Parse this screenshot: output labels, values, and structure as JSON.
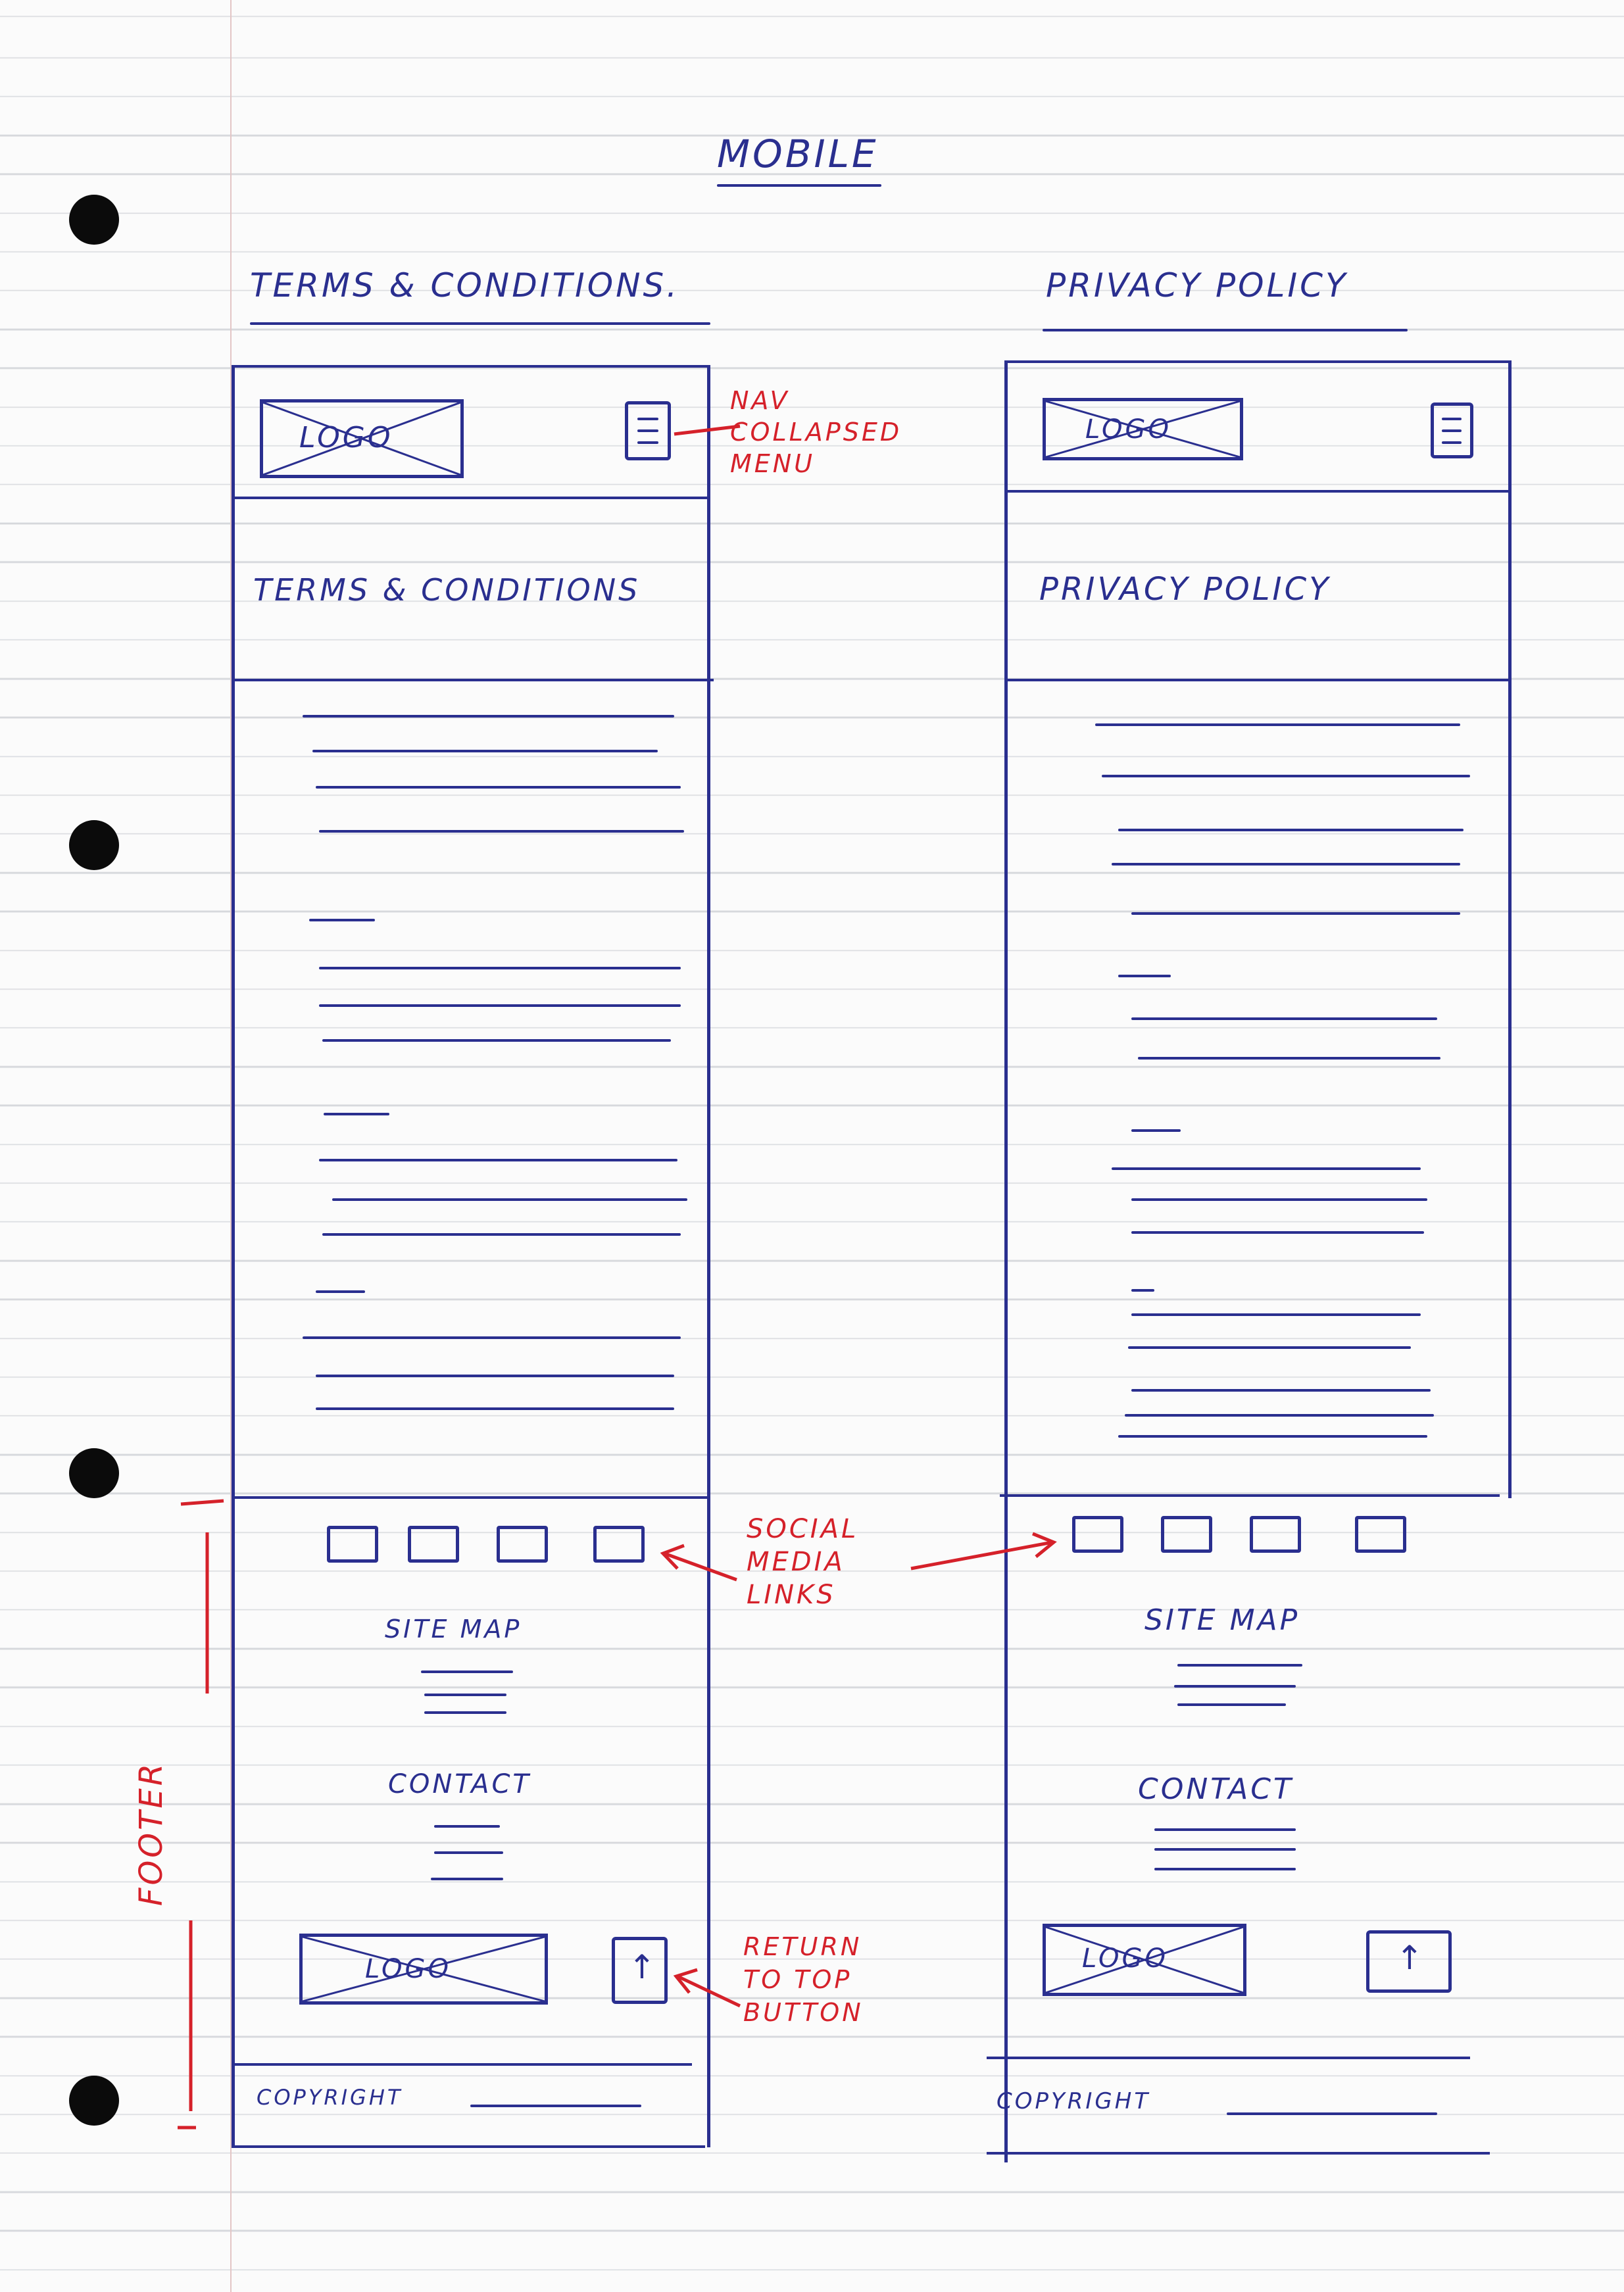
{
  "page_title": "MOBILE",
  "wireframes": [
    {
      "heading": "TERMS & CONDITIONS.",
      "page_heading": "TERMS & CONDITIONS",
      "logo_label": "LOGO",
      "footer_sitemap": "SITE MAP",
      "footer_contact": "CONTACT",
      "footer_logo_label": "LOGO",
      "copyright": "COPYRIGHT"
    },
    {
      "heading": "PRIVACY POLICY",
      "page_heading": "PRIVACY POLICY",
      "logo_label": "LOGO",
      "footer_sitemap": "SITE MAP",
      "footer_contact": "CONTACT",
      "footer_logo_label": "LOGO",
      "copyright": "COPYRIGHT"
    }
  ],
  "annotations": {
    "nav_menu": "NAV COLLAPSED MENU",
    "social_links": "SOCIAL MEDIA LINKS",
    "return_top": "RETURN TO TOP BUTTON",
    "footer": "FOOTER"
  },
  "colors": {
    "ink": "#2a2f8f",
    "annotation": "#d5212a",
    "paper": "#fbfbfb",
    "rule": "#d6d8dc"
  }
}
